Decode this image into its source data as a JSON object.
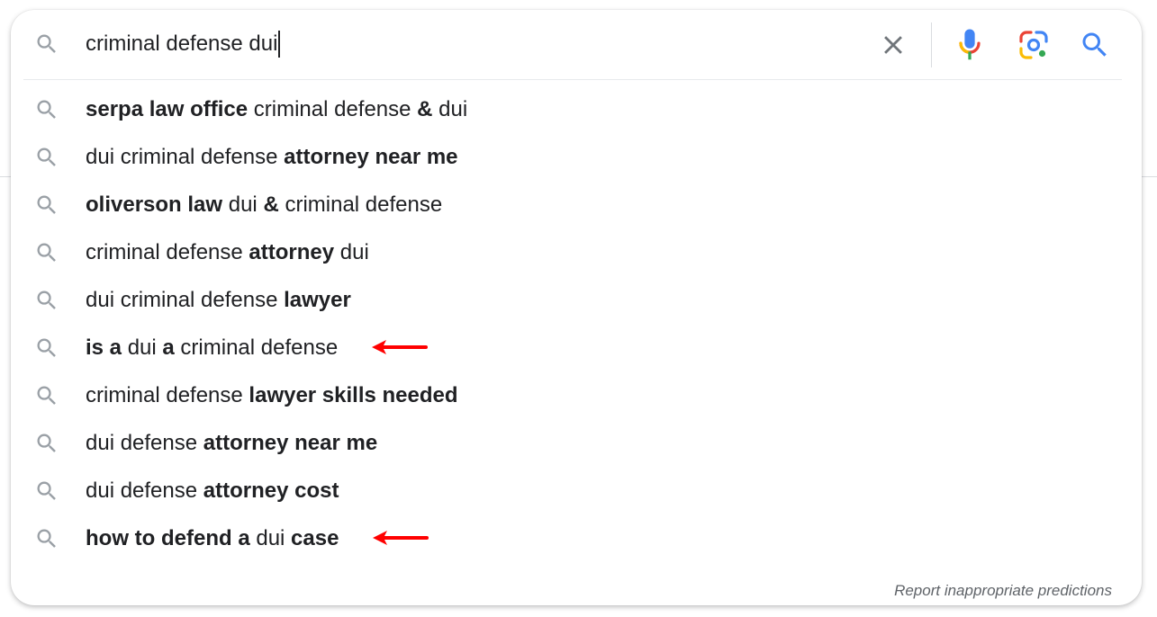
{
  "search": {
    "query": "criminal defense dui",
    "clear_icon": "close-icon",
    "voice_icon": "microphone-icon",
    "lens_icon": "camera-lens-icon",
    "submit_icon": "search-icon"
  },
  "suggestions": [
    {
      "segments": [
        {
          "text": "serpa law office",
          "bold": true
        },
        {
          "text": " criminal defense ",
          "bold": false
        },
        {
          "text": "&",
          "bold": true
        },
        {
          "text": " dui",
          "bold": false
        }
      ],
      "annotated": false
    },
    {
      "segments": [
        {
          "text": "dui criminal defense ",
          "bold": false
        },
        {
          "text": "attorney near me",
          "bold": true
        }
      ],
      "annotated": false
    },
    {
      "segments": [
        {
          "text": "oliverson law",
          "bold": true
        },
        {
          "text": " dui ",
          "bold": false
        },
        {
          "text": "&",
          "bold": true
        },
        {
          "text": " criminal defense",
          "bold": false
        }
      ],
      "annotated": false
    },
    {
      "segments": [
        {
          "text": "criminal defense ",
          "bold": false
        },
        {
          "text": "attorney",
          "bold": true
        },
        {
          "text": " dui",
          "bold": false
        }
      ],
      "annotated": false
    },
    {
      "segments": [
        {
          "text": "dui criminal defense ",
          "bold": false
        },
        {
          "text": "lawyer",
          "bold": true
        }
      ],
      "annotated": false
    },
    {
      "segments": [
        {
          "text": "is a",
          "bold": true
        },
        {
          "text": " dui ",
          "bold": false
        },
        {
          "text": "a",
          "bold": true
        },
        {
          "text": " criminal defense",
          "bold": false
        }
      ],
      "annotated": true
    },
    {
      "segments": [
        {
          "text": "criminal defense ",
          "bold": false
        },
        {
          "text": "lawyer skills needed",
          "bold": true
        }
      ],
      "annotated": false
    },
    {
      "segments": [
        {
          "text": "dui defense ",
          "bold": false
        },
        {
          "text": "attorney near me",
          "bold": true
        }
      ],
      "annotated": false
    },
    {
      "segments": [
        {
          "text": "dui defense ",
          "bold": false
        },
        {
          "text": "attorney cost",
          "bold": true
        }
      ],
      "annotated": false
    },
    {
      "segments": [
        {
          "text": "how to defend a",
          "bold": true
        },
        {
          "text": " dui ",
          "bold": false
        },
        {
          "text": "case",
          "bold": true
        }
      ],
      "annotated": true
    }
  ],
  "footer": {
    "report_label": "Report inappropriate predictions"
  },
  "colors": {
    "text": "#202124",
    "icon_gray": "#70757a",
    "google_blue": "#4285f4",
    "google_red": "#ea4335",
    "google_yellow": "#fbbc04",
    "google_green": "#34a853",
    "annotation_arrow": "#ff0000"
  }
}
